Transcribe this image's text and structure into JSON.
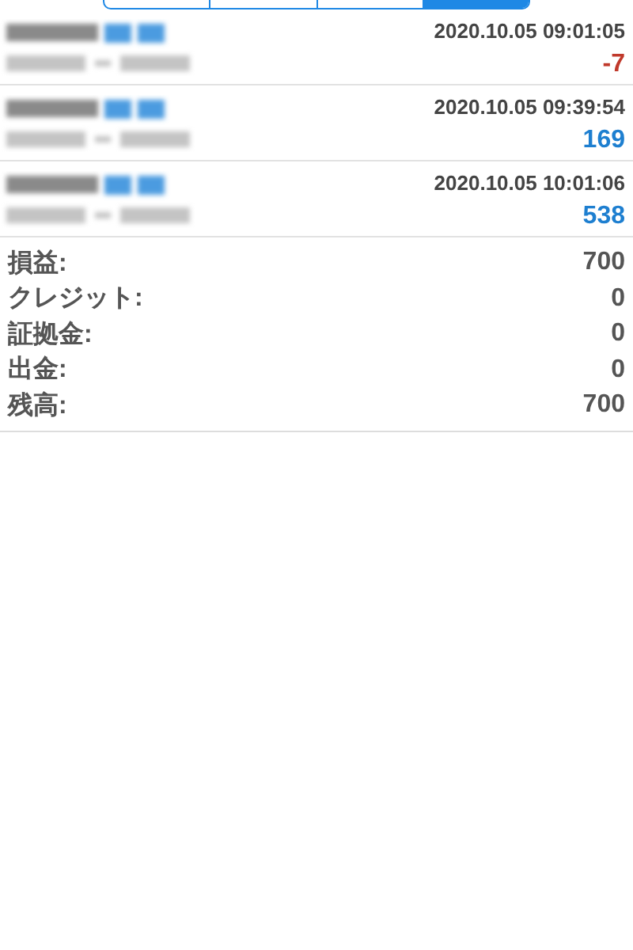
{
  "segments": [
    {
      "selected": false
    },
    {
      "selected": false
    },
    {
      "selected": false
    },
    {
      "selected": true
    }
  ],
  "trades": [
    {
      "time": "2020.10.05 09:01:05",
      "profit": "-7",
      "color": "#c0392b"
    },
    {
      "time": "2020.10.05 09:39:54",
      "profit": "169",
      "color": "#1e7fd0"
    },
    {
      "time": "2020.10.05 10:01:06",
      "profit": "538",
      "color": "#1e7fd0"
    }
  ],
  "summary": [
    {
      "label": "損益:",
      "value": "700"
    },
    {
      "label": "クレジット:",
      "value": "0"
    },
    {
      "label": "証拠金:",
      "value": "0"
    },
    {
      "label": "出金:",
      "value": "0"
    },
    {
      "label": "残高:",
      "value": "700"
    }
  ]
}
